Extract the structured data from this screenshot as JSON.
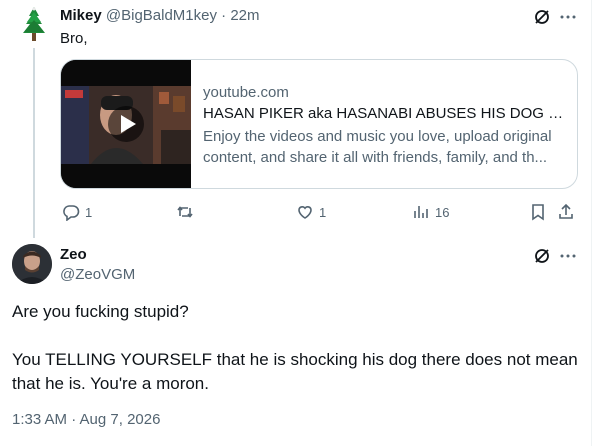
{
  "reply": {
    "name": "Mikey",
    "handle": "@BigBaldM1key",
    "separator": "·",
    "time": "22m",
    "text": "Bro,",
    "card": {
      "domain": "youtube.com",
      "title": "HASAN PIKER aka HASANABI ABUSES HIS DOG W...",
      "description": "Enjoy the videos and music you love, upload original content, and share it all with friends, family, and th..."
    },
    "actions": {
      "replies": "1",
      "reposts": "",
      "likes": "1",
      "views": "16"
    }
  },
  "tweet": {
    "name": "Zeo",
    "handle": "@ZeoVGM",
    "paragraphs": [
      "Are you fucking stupid?",
      "You TELLING YOURSELF that he is shocking his dog there does not mean that he is. You're a moron."
    ],
    "timestamp": "1:33 AM · Aug 7, 2026"
  },
  "colors": {
    "text": "#0f1419",
    "secondary": "#536471",
    "border": "#cfd9de",
    "youtube_red": "#ff0000"
  },
  "icons": [
    "tree-avatar-icon",
    "grok-icon",
    "more-icon",
    "play-icon",
    "reply-icon",
    "repost-icon",
    "like-icon",
    "views-icon",
    "bookmark-icon",
    "share-icon"
  ]
}
